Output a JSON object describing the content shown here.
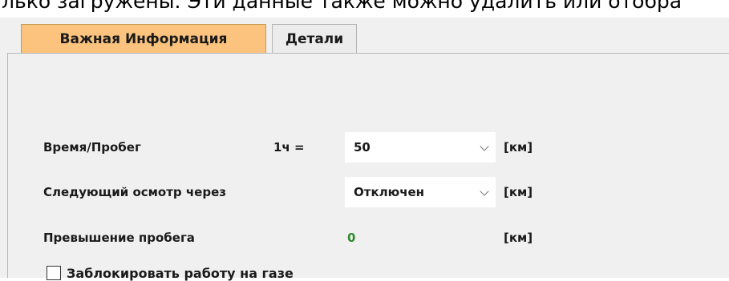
{
  "header_text": "лько загружены. Эти данные также можно удалить или отобра",
  "tabs": [
    {
      "label": "Важная Информация",
      "active": true
    },
    {
      "label": "Детали",
      "active": false
    }
  ],
  "form": {
    "time_mileage_label": "Время/Пробег",
    "time_mileage_eq": "1ч =",
    "time_mileage_value": "50",
    "time_mileage_unit": "[км]",
    "next_inspection_label": "Следующий осмотр через",
    "next_inspection_value": "Отключен",
    "next_inspection_unit": "[км]",
    "overrun_label": "Превышение пробега",
    "overrun_value": "0",
    "overrun_unit": "[км]",
    "block_gas_label": "Заблокировать работу на газе",
    "block_gas_checked": false
  },
  "colors": {
    "active_tab": "#fbc37d",
    "window_bg": "#f0f0f0",
    "value_green": "#2e8b2e"
  }
}
